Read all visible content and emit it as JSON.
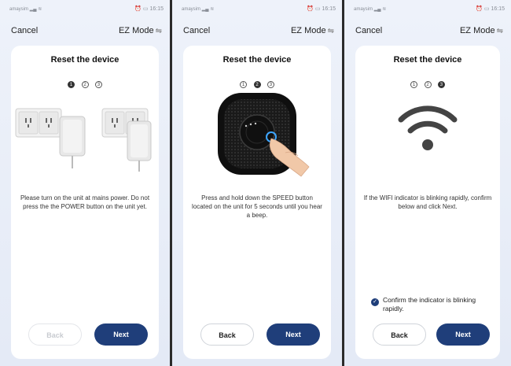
{
  "screens": [
    {
      "status": {
        "carrier": "amaysim",
        "signal": "▂▄ ≋",
        "right": "⏰ ▭ 16:15"
      },
      "nav": {
        "cancel": "Cancel",
        "mode": "EZ Mode",
        "swap_icon": "⇋"
      },
      "title": "Reset the device",
      "steps": [
        "1",
        "2",
        "3"
      ],
      "active_step": 1,
      "instruction": "Please turn on the unit at mains power. Do not press the the POWER button on the unit yet.",
      "back": "Back",
      "next": "Next",
      "back_disabled": true
    },
    {
      "status": {
        "carrier": "amaysim",
        "signal": "▂▄ ≋",
        "right": "⏰ ▭ 16:15"
      },
      "nav": {
        "cancel": "Cancel",
        "mode": "EZ Mode",
        "swap_icon": "⇋"
      },
      "title": "Reset the device",
      "steps": [
        "1",
        "2",
        "3"
      ],
      "active_step": 2,
      "instruction": "Press and hold down the SPEED button located on the unit for 5 seconds until you hear a beep.",
      "back": "Back",
      "next": "Next",
      "back_disabled": false
    },
    {
      "status": {
        "carrier": "amaysim",
        "signal": "▂▄ ≋",
        "right": "⏰ ▭ 16:15"
      },
      "nav": {
        "cancel": "Cancel",
        "mode": "EZ Mode",
        "swap_icon": "⇋"
      },
      "title": "Reset the device",
      "steps": [
        "1",
        "2",
        "3"
      ],
      "active_step": 3,
      "instruction": "If the WIFI indicator is blinking rapidly, confirm below and click Next.",
      "confirm": "Confirm the indicator is blinking rapidly.",
      "confirm_checked": true,
      "back": "Back",
      "next": "Next",
      "back_disabled": false
    }
  ],
  "colors": {
    "primary": "#1f3e7a",
    "background": "#e9eef8",
    "card": "#ffffff"
  }
}
